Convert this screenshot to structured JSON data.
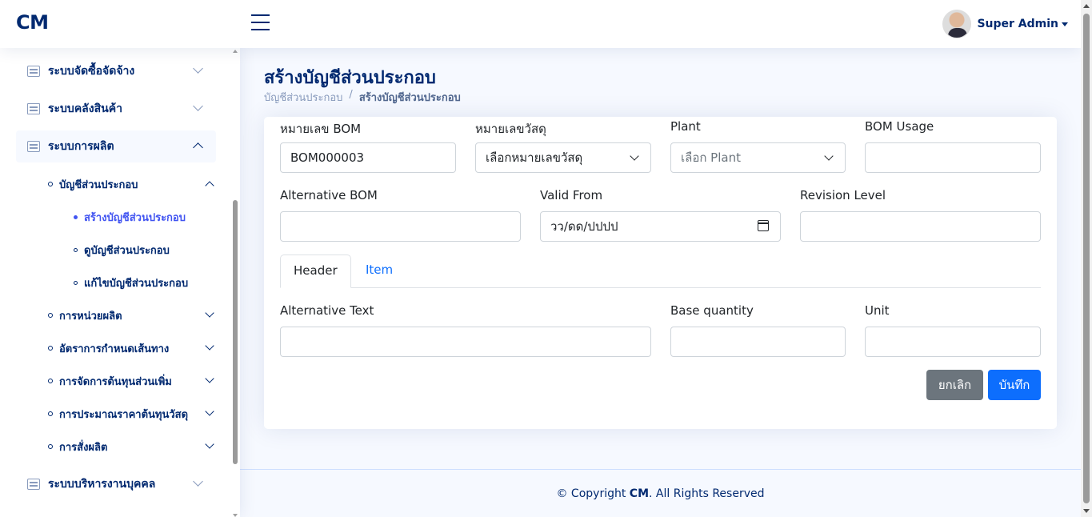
{
  "header": {
    "logo": "CM",
    "user_name": "Super Admin"
  },
  "sidebar": {
    "items": [
      {
        "label": "ระบบจัดซื้อจัดจ้าง"
      },
      {
        "label": "ระบบคลังสินค้า"
      },
      {
        "label": "ระบบการผลิต"
      },
      {
        "label": "ระบบบริหารงานบุคคล"
      }
    ],
    "sub_items": [
      {
        "label": "บัญชีส่วนประกอบ"
      },
      {
        "label": "การหน่วยผลิต"
      },
      {
        "label": "อัตราการกำหนดเส้นทาง"
      },
      {
        "label": "การจัดการต้นทุนส่วนเพิ่ม"
      },
      {
        "label": "การประมาณราคาต้นทุนวัสดุ"
      },
      {
        "label": "การสั่งผลิต"
      }
    ],
    "bom_children": [
      {
        "label": "สร้างบัญชีส่วนประกอบ"
      },
      {
        "label": "ดูบัญชีส่วนประกอบ"
      },
      {
        "label": "แก้ไขบัญชีส่วนประกอบ"
      }
    ]
  },
  "page": {
    "title": "สร้างบัญชีส่วนประกอบ",
    "breadcrumb": [
      "บัญชีส่วนประกอบ",
      "สร้างบัญชีส่วนประกอบ"
    ],
    "breadcrumb_sep": "/"
  },
  "form": {
    "bom_no_label": "หมายเลข BOM",
    "bom_no_value": "BOM000003",
    "material_label": "หมายเลขวัสดุ",
    "material_value": "เลือกหมายเลขวัสดุ",
    "plant_label": "Plant",
    "plant_placeholder": "เลือก Plant",
    "bom_usage_label": "BOM Usage",
    "bom_usage_value": "",
    "alt_bom_label": "Alternative BOM",
    "alt_bom_value": "",
    "valid_from_label": "Valid From",
    "valid_from_placeholder": "วว/ดด/ปปปป",
    "revision_label": "Revision Level",
    "revision_value": "",
    "tabs": [
      {
        "label": "Header"
      },
      {
        "label": "Item"
      }
    ],
    "alt_text_label": "Alternative Text",
    "alt_text_value": "",
    "base_qty_label": "Base quantity",
    "base_qty_value": "",
    "unit_label": "Unit",
    "unit_value": "",
    "cancel_label": "ยกเลิก",
    "save_label": "บันทึก"
  },
  "footer": {
    "prefix": "© Copyright ",
    "brand": "CM",
    "suffix": ". All Rights Reserved"
  }
}
